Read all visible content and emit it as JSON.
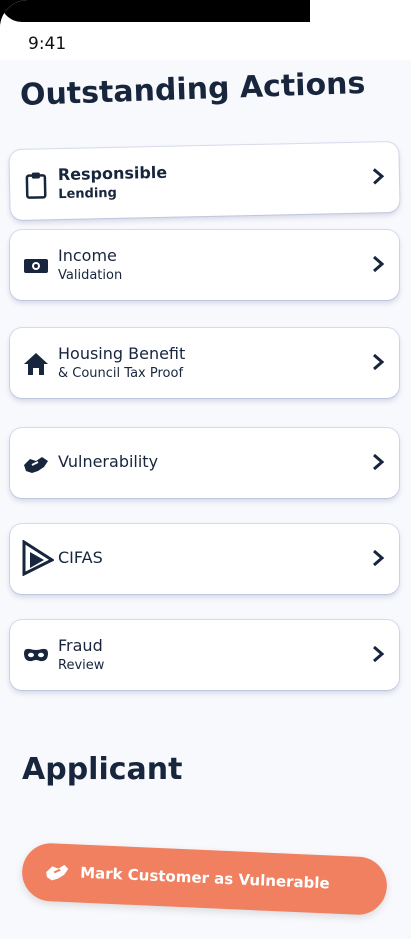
{
  "status_bar": {
    "time": "9:41"
  },
  "heading": "Outstanding Actions",
  "actions": [
    {
      "title": "Responsible",
      "subtitle": "Lending",
      "icon": "clipboard-icon"
    },
    {
      "title": "Income",
      "subtitle": "Validation",
      "icon": "cash-icon"
    },
    {
      "title": "Housing Benefit",
      "subtitle": "& Council Tax Proof",
      "icon": "home-icon"
    },
    {
      "title": "Vulnerability",
      "icon": "handshake-icon"
    },
    {
      "title": "CIFAS",
      "icon": "cifas-logo-icon"
    },
    {
      "title": "Fraud",
      "subtitle": "Review",
      "icon": "mask-icon"
    }
  ],
  "section_title": "Applicant",
  "cta": {
    "label": "Mark Customer as Vulnerable",
    "color": "#f08060"
  },
  "colors": {
    "text": "#17253d",
    "background": "#f8f9fd"
  }
}
